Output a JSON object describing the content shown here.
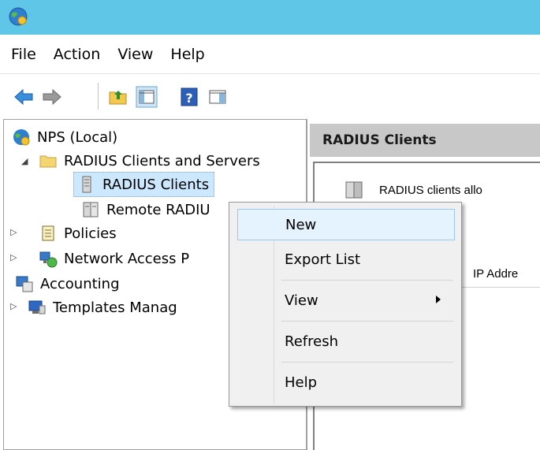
{
  "window": {
    "app_icon": "nps-globe-icon"
  },
  "menubar": {
    "items": [
      "File",
      "Action",
      "View",
      "Help"
    ]
  },
  "toolbar": {
    "buttons": [
      "back-arrow-icon",
      "forward-arrow-icon",
      "up-folder-icon",
      "show-hide-console-tree-icon",
      "help-icon",
      "show-hide-action-pane-icon"
    ]
  },
  "tree": {
    "root": "NPS (Local)",
    "radius_group": "RADIUS Clients and Servers",
    "radius_clients": "RADIUS Clients",
    "remote_radius": "Remote RADIU",
    "policies": "Policies",
    "network_access": "Network Access P",
    "accounting": "Accounting",
    "templates": "Templates Manag"
  },
  "right_pane": {
    "header": "RADIUS Clients",
    "description": "RADIUS clients allo",
    "column_ip": "IP Addre"
  },
  "context_menu": {
    "new": "New",
    "export_list": "Export List",
    "view": "View",
    "refresh": "Refresh",
    "help": "Help"
  },
  "colors": {
    "titlebar": "#5fc6e8",
    "selection": "#cce8ff",
    "menu_hover": "#e5f3ff",
    "header_gray": "#c8c8c8"
  }
}
